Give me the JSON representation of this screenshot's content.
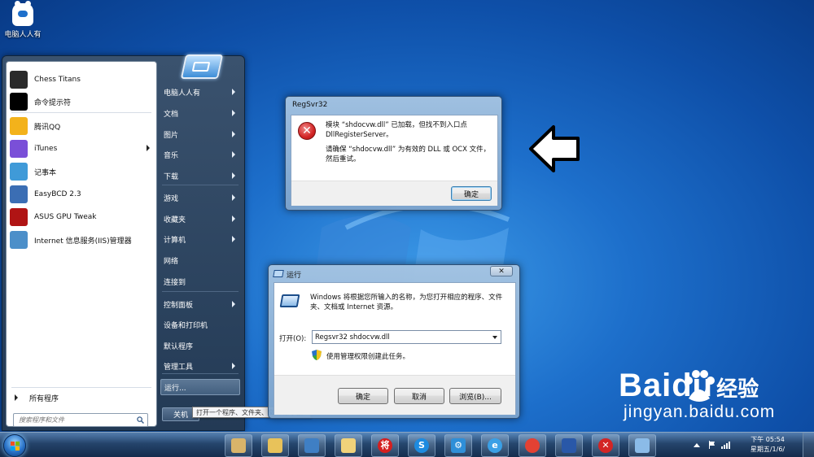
{
  "desktop": {
    "icon_label": "电脑人人有"
  },
  "start_menu": {
    "programs": [
      {
        "label": "Chess Titans",
        "icon": "chess-icon",
        "color": "#2a2a2a"
      },
      {
        "label": "命令提示符",
        "icon": "cmd-icon",
        "color": "#000000"
      },
      {
        "label": "腾讯QQ",
        "icon": "qq-icon",
        "color": "#f3b21b"
      },
      {
        "label": "iTunes",
        "icon": "itunes-icon",
        "color": "#7a4fd8"
      },
      {
        "label": "记事本",
        "icon": "notepad-icon",
        "color": "#3f9ad8"
      },
      {
        "label": "EasyBCD 2.3",
        "icon": "easybcd-icon",
        "color": "#3b6eb4"
      },
      {
        "label": "ASUS GPU Tweak",
        "icon": "asus-icon",
        "color": "#b01414"
      },
      {
        "label": "Internet 信息服务(IIS)管理器",
        "icon": "iis-icon",
        "color": "#4c8fc9"
      }
    ],
    "all_programs": "所有程序",
    "search_placeholder": "搜索程序和文件",
    "right_items": [
      {
        "label": "电脑人人有",
        "arrow": true
      },
      {
        "label": "文档",
        "arrow": true
      },
      {
        "label": "图片",
        "arrow": true
      },
      {
        "label": "音乐",
        "arrow": true
      },
      {
        "label": "下载",
        "arrow": true
      },
      {
        "label": "游戏",
        "arrow": true
      },
      {
        "label": "收藏夹",
        "arrow": true
      },
      {
        "label": "计算机",
        "arrow": true
      },
      {
        "label": "网络",
        "arrow": false
      },
      {
        "label": "连接到",
        "arrow": false
      },
      {
        "label": "控制面板",
        "arrow": true
      },
      {
        "label": "设备和打印机",
        "arrow": false
      },
      {
        "label": "默认程序",
        "arrow": false
      },
      {
        "label": "管理工具",
        "arrow": true
      },
      {
        "label": "运行...",
        "arrow": false
      }
    ],
    "shutdown": "关机",
    "tooltip": "打开一个程序、文件夹、文档或网站。"
  },
  "regsvr_dialog": {
    "title": "RegSvr32",
    "message_line1": "模块 “shdocvw.dll” 已加载，但找不到入口点 DllRegisterServer。",
    "message_line2": "请确保 “shdocvw.dll” 为有效的 DLL 或 OCX 文件，然后重试。",
    "ok": "确定"
  },
  "run_dialog": {
    "title": "运行",
    "close": "✕",
    "description": "Windows 将根据您所输入的名称，为您打开相应的程序、文件夹、文档或 Internet 资源。",
    "open_label": "打开(O):",
    "open_value": "Regsvr32 shdocvw.dll",
    "admin_note": "使用管理权限创建此任务。",
    "ok": "确定",
    "cancel": "取消",
    "browse": "浏览(B)..."
  },
  "watermark": {
    "bai": "Bai",
    "du": "du",
    "cn": "经验",
    "url": "jingyan.baidu.com"
  },
  "taskbar": {
    "buttons": [
      {
        "name": "paint-icon",
        "color": "#d9b46a",
        "glyph": ""
      },
      {
        "name": "explorer-icon",
        "color": "#e8c25a",
        "glyph": ""
      },
      {
        "name": "network-icon",
        "color": "#3f7fc4",
        "glyph": ""
      },
      {
        "name": "folder-icon",
        "color": "#f0d27a",
        "glyph": ""
      },
      {
        "name": "chess-app-icon",
        "color": "#d51f1f",
        "glyph": "将"
      },
      {
        "name": "sogou-icon",
        "color": "#1e8be0",
        "glyph": "S"
      },
      {
        "name": "gear-icon",
        "color": "#2f8fd8",
        "glyph": "⚙"
      },
      {
        "name": "ie-icon",
        "color": "#3aa0e6",
        "glyph": "e"
      },
      {
        "name": "chrome-icon",
        "color": "#e34133",
        "glyph": ""
      },
      {
        "name": "remote-icon",
        "color": "#2958a8",
        "glyph": ""
      },
      {
        "name": "error-app-icon",
        "color": "#d32525",
        "glyph": "✕"
      },
      {
        "name": "run-app-icon",
        "color": "#8bbbe8",
        "glyph": ""
      }
    ],
    "clock_time": "下午 05:54",
    "clock_date": "星期五/1/6/"
  }
}
